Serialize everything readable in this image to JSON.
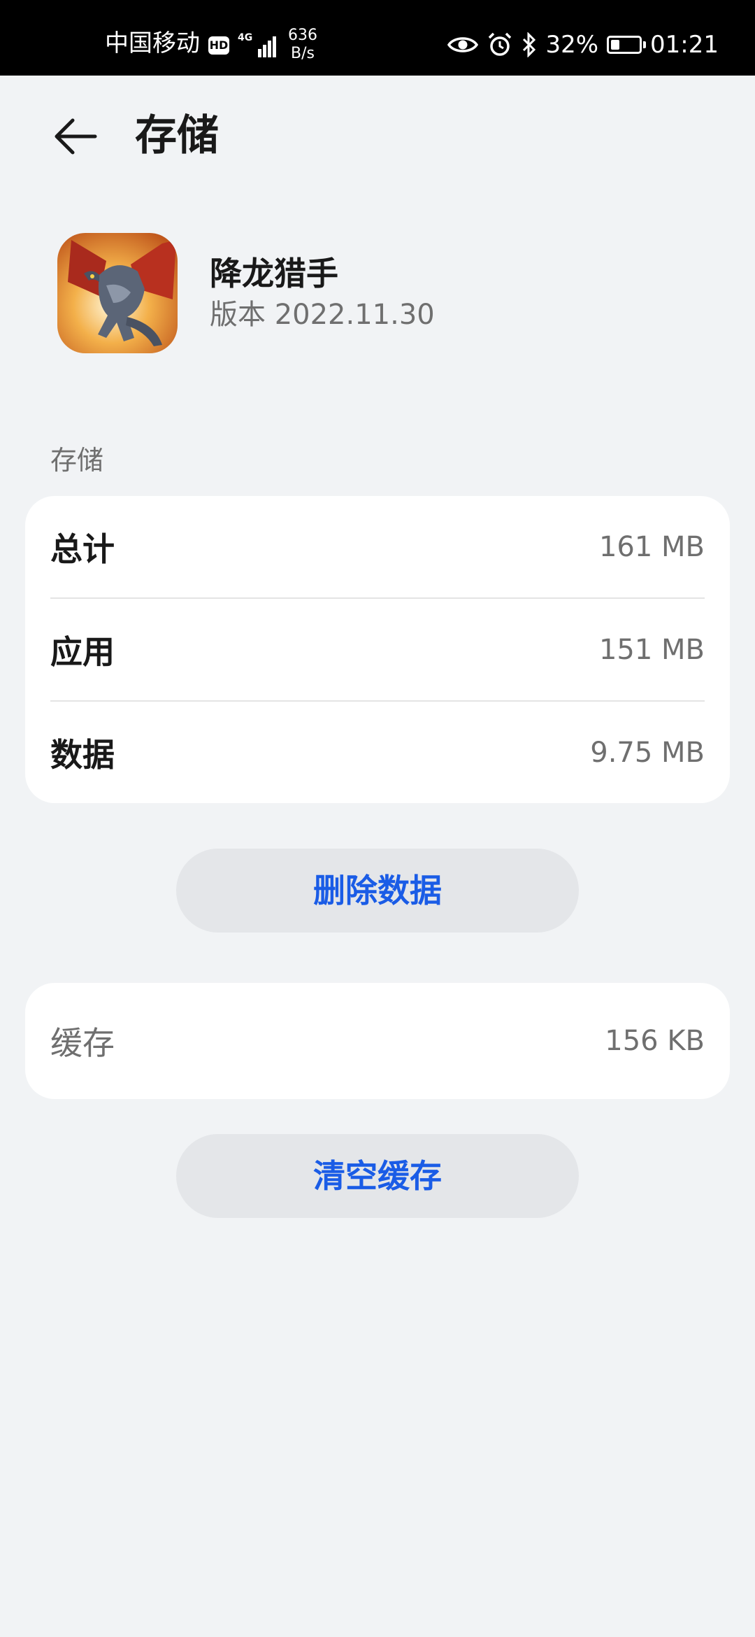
{
  "status_bar": {
    "carrier": "中国移动",
    "hd": "HD",
    "network": "4G",
    "speed_value": "636",
    "speed_unit": "B/s",
    "battery": "32%",
    "battery_level": 0.32,
    "time": "01:21",
    "icons": [
      "eye-icon",
      "alarm-icon",
      "bluetooth-icon",
      "battery-icon"
    ]
  },
  "header": {
    "title": "存储",
    "back_icon": "back-arrow-icon"
  },
  "app": {
    "name": "降龙猎手",
    "version": "版本 2022.11.30",
    "icon": "dragon-app-icon"
  },
  "storage": {
    "section_label": "存储",
    "rows": [
      {
        "label": "总计",
        "value": "161 MB"
      },
      {
        "label": "应用",
        "value": "151 MB"
      },
      {
        "label": "数据",
        "value": "9.75 MB"
      }
    ],
    "delete_button": "删除数据"
  },
  "cache": {
    "label": "缓存",
    "value": "156 KB",
    "clear_button": "清空缓存"
  },
  "colors": {
    "accent": "#1a5ce6",
    "background": "#f1f3f5",
    "card": "#ffffff",
    "button": "#e4e6e9"
  }
}
